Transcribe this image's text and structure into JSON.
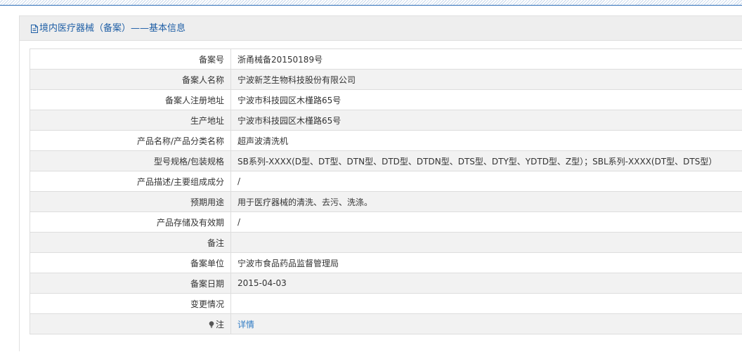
{
  "panel": {
    "title": "境内医疗器械（备案）——基本信息",
    "icon": "document-icon"
  },
  "colors": {
    "accent": "#1f5fa6",
    "link": "#2f7bc4",
    "row_alt": "#f2f2f2",
    "border": "#dddddd"
  },
  "rows": [
    {
      "label": "备案号",
      "value": "浙甬械备20150189号"
    },
    {
      "label": "备案人名称",
      "value": "宁波新芝生物科技股份有限公司"
    },
    {
      "label": "备案人注册地址",
      "value": "宁波市科技园区木槿路65号"
    },
    {
      "label": "生产地址",
      "value": "宁波市科技园区木槿路65号"
    },
    {
      "label": "产品名称/产品分类名称",
      "value": "超声波清洗机"
    },
    {
      "label": "型号规格/包装规格",
      "value": "SB系列-XXXX(D型、DT型、DTN型、DTD型、DTDN型、DTS型、DTY型、YDTD型、Z型）；SBL系列-XXXX(DT型、DTS型）"
    },
    {
      "label": "产品描述/主要组成成分",
      "value": "/"
    },
    {
      "label": "预期用途",
      "value": "用于医疗器械的清洗、去污、洗涤。"
    },
    {
      "label": "产品存储及有效期",
      "value": "/"
    },
    {
      "label": "备注",
      "value": ""
    },
    {
      "label": "备案单位",
      "value": "宁波市食品药品监督管理局"
    },
    {
      "label": "备案日期",
      "value": "2015-04-03"
    },
    {
      "label": "变更情况",
      "value": ""
    },
    {
      "label": "注",
      "value": "详情",
      "icon": "lightbulb-icon"
    }
  ]
}
